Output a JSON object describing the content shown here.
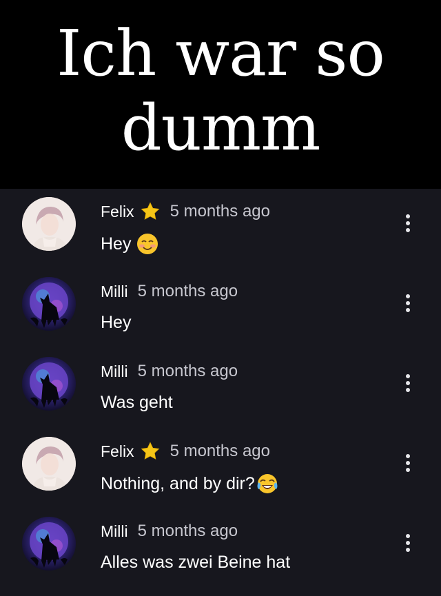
{
  "caption": "Ich war so dumm",
  "comments": [
    {
      "author": "Felix",
      "time": "5 months ago",
      "text": "Hey",
      "avatar": "felix-avatar",
      "star": true,
      "emoji": "smiling-blush-emoji"
    },
    {
      "author": "Milli",
      "time": "5 months ago",
      "text": "Hey",
      "avatar": "milli-wolf-avatar",
      "star": false,
      "emoji": null
    },
    {
      "author": "Milli",
      "time": "5 months ago",
      "text": "Was geht",
      "avatar": "milli-wolf-avatar",
      "star": false,
      "emoji": null
    },
    {
      "author": "Felix",
      "time": "5 months ago",
      "text": "Nothing, and by dir?",
      "avatar": "felix-avatar",
      "star": true,
      "emoji": "tears-of-joy-emoji"
    },
    {
      "author": "Milli",
      "time": "5 months ago",
      "text": "Alles was zwei Beine hat",
      "avatar": "milli-wolf-avatar",
      "star": false,
      "emoji": null
    }
  ],
  "colors": {
    "caption_bg": "#000000",
    "feed_bg": "#17171e",
    "star": "#f5c518",
    "time": "#c7c7cf"
  }
}
